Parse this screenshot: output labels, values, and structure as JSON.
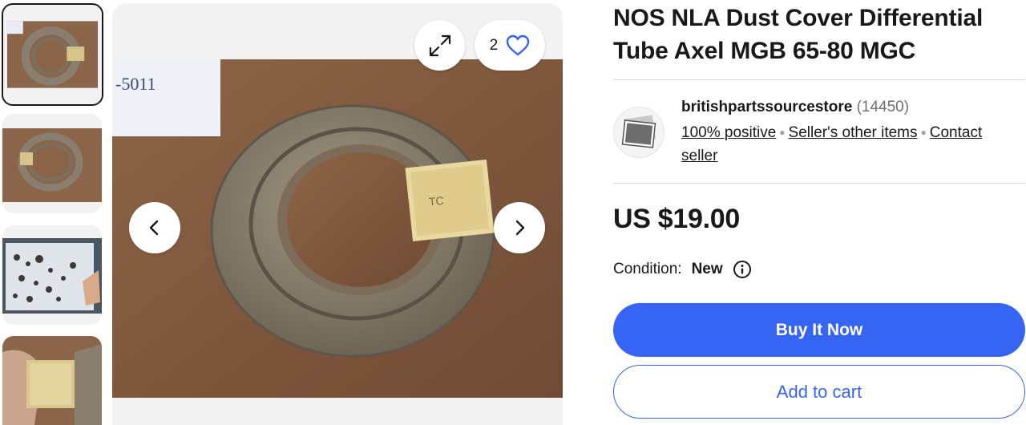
{
  "gallery": {
    "thumbnails": [
      "thumb-ring-top",
      "thumb-ring-side",
      "thumb-parts-catalog",
      "thumb-ring-closeup"
    ],
    "watch_count": "2",
    "icons": {
      "expand": "expand-icon",
      "watch": "heart-icon",
      "prev": "chevron-left-icon",
      "next": "chevron-right-icon"
    }
  },
  "listing": {
    "title": "NOS NLA Dust Cover Differential Tube Axel MGB 65-80 MGC",
    "price": "US $19.00",
    "condition_label": "Condition:",
    "condition_value": "New"
  },
  "seller": {
    "name": "britishpartssourcestore",
    "feedback_count": "(14450)",
    "positive": "100% positive",
    "other_items": "Seller's other items",
    "contact": "Contact seller"
  },
  "actions": {
    "buy_now": "Buy It Now",
    "add_to_cart": "Add to cart"
  },
  "colors": {
    "accent": "#3665f3",
    "text": "#191919",
    "muted": "#707070",
    "divider": "#d9d9d9"
  }
}
